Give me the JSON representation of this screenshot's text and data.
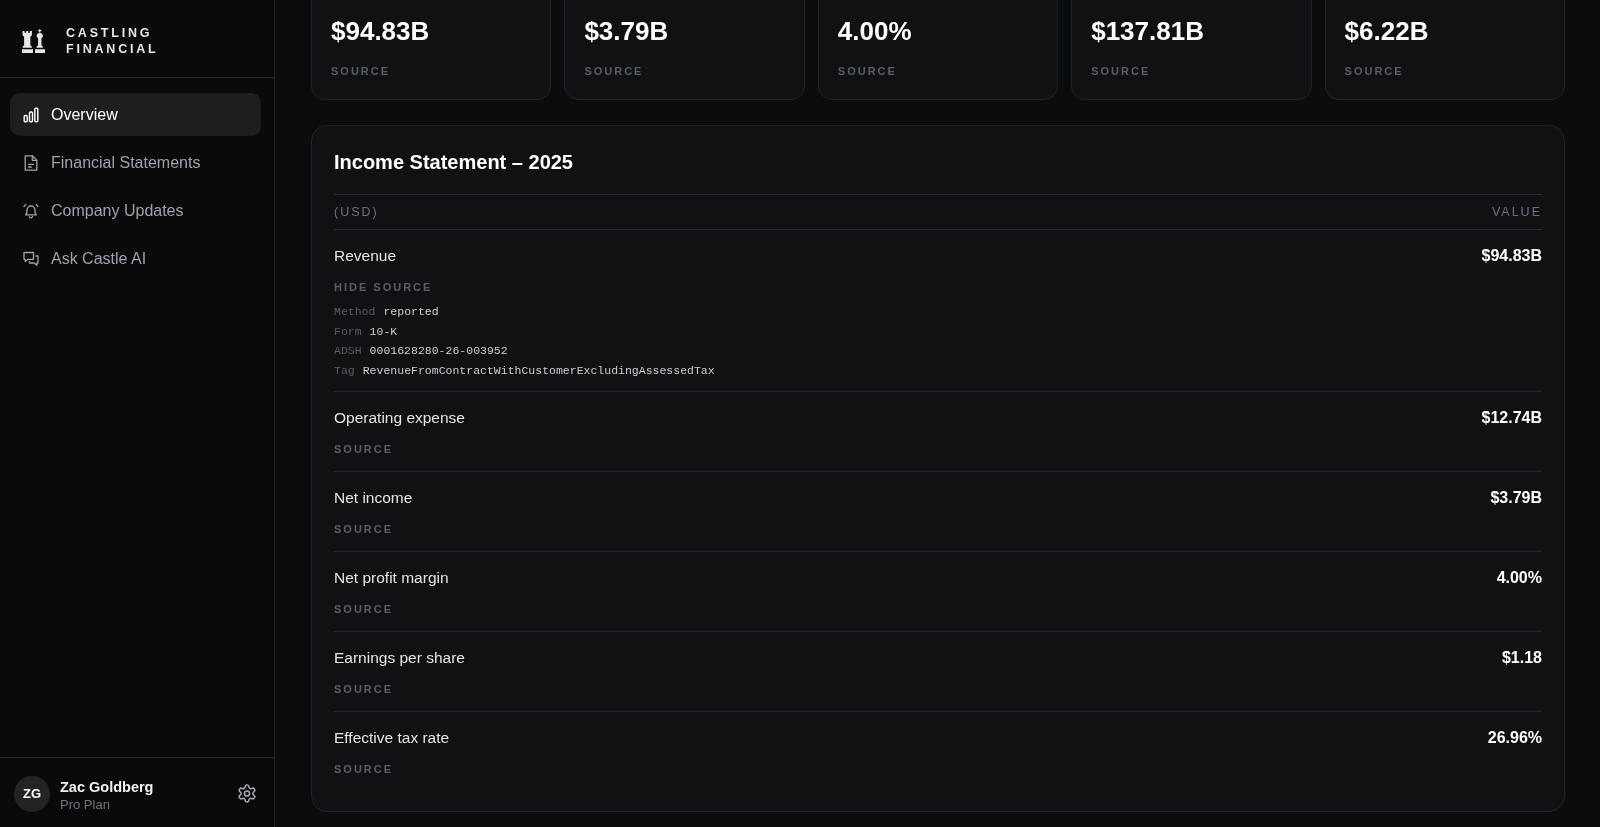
{
  "sidebar": {
    "brand": "CASTLING FINANCIAL",
    "nav": [
      {
        "label": "Overview",
        "selected": true
      },
      {
        "label": "Financial Statements",
        "selected": false
      },
      {
        "label": "Company Updates",
        "selected": false
      },
      {
        "label": "Ask Castle AI",
        "selected": false
      }
    ],
    "user": {
      "initials": "ZG",
      "name": "Zac Goldberg",
      "plan": "Pro Plan"
    }
  },
  "metric_cards": [
    {
      "value": "$94.83B",
      "source_button": "SOURCE"
    },
    {
      "value": "$3.79B",
      "source_button": "SOURCE"
    },
    {
      "value": "4.00%",
      "source_button": "SOURCE"
    },
    {
      "value": "$137.81B",
      "source_button": "SOURCE"
    },
    {
      "value": "$6.22B",
      "source_button": "SOURCE"
    }
  ],
  "income_statement": {
    "title": "Income Statement – 2025",
    "columns": [
      "(USD)",
      "VALUE"
    ],
    "rows": [
      {
        "label": "Revenue",
        "value": "$94.83B",
        "source_button": "HIDE SOURCE",
        "source_details": [
          {
            "key": "Method",
            "value": "reported"
          },
          {
            "key": "Form",
            "value": "10-K"
          },
          {
            "key": "ADSH",
            "value": "0001628280-26-003952"
          },
          {
            "key": "Tag",
            "value": "RevenueFromContractWithCustomerExcludingAssessedTax"
          }
        ]
      },
      {
        "label": "Operating expense",
        "value": "$12.74B",
        "source_button": "SOURCE"
      },
      {
        "label": "Net income",
        "value": "$3.79B",
        "source_button": "SOURCE"
      },
      {
        "label": "Net profit margin",
        "value": "4.00%",
        "source_button": "SOURCE"
      },
      {
        "label": "Earnings per share",
        "value": "$1.18",
        "source_button": "SOURCE"
      },
      {
        "label": "Effective tax rate",
        "value": "26.96%",
        "source_button": "SOURCE"
      }
    ]
  }
}
